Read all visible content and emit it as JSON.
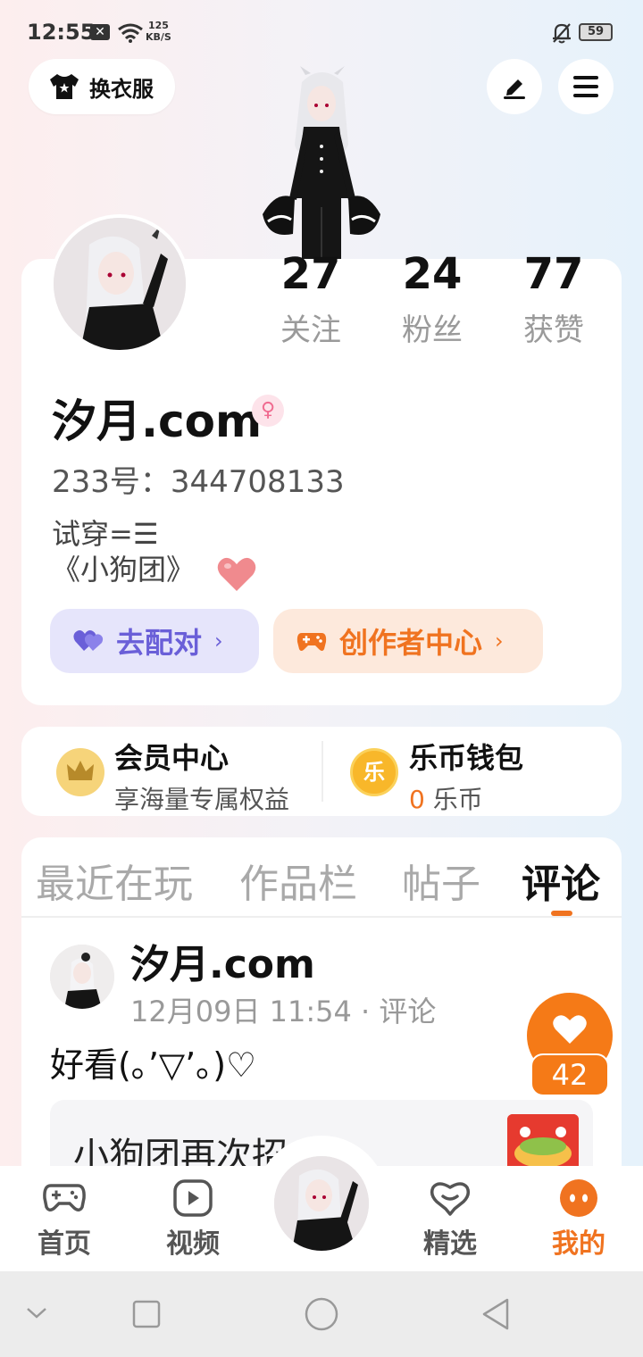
{
  "status_bar": {
    "time": "12:55",
    "notification_badge": "✕",
    "net_speed_value": "125",
    "net_speed_unit": "KB/S",
    "battery": "59"
  },
  "header": {
    "outfit_label": "换衣服"
  },
  "profile": {
    "name": "汐月.com",
    "gender_badge": "♀",
    "id_label": "233号：344708133",
    "bio_line1": "试穿=☰",
    "bio_line2": "《小狗团》",
    "stats": [
      {
        "value": "27",
        "label": "关注"
      },
      {
        "value": "24",
        "label": "粉丝"
      },
      {
        "value": "77",
        "label": "获赞"
      }
    ],
    "match_label": "去配对",
    "creator_label": "创作者中心",
    "chevron": "›"
  },
  "vip": {
    "title": "会员中心",
    "subtitle": "享海量专属权益"
  },
  "wallet": {
    "coin_glyph": "乐",
    "title": "乐币钱包",
    "amount": "0",
    "unit": " 乐币"
  },
  "tabs": [
    {
      "label": "最近在玩",
      "active": false
    },
    {
      "label": "作品栏",
      "active": false
    },
    {
      "label": "帖子",
      "active": false
    },
    {
      "label": "评论",
      "active": true
    }
  ],
  "post": {
    "author": "汐月.com",
    "meta": "12月09日 11:54 · 评论",
    "text": "好看(｡’▽’｡)♡",
    "likes": "42",
    "quote_text": "小狗团再次招"
  },
  "bottom_nav": [
    {
      "label": "首页",
      "icon": "gamepad-icon",
      "active": false
    },
    {
      "label": "视频",
      "icon": "video-play-icon",
      "active": false
    },
    {
      "label": "精选",
      "icon": "heart-chat-icon",
      "active": false
    },
    {
      "label": "我的",
      "icon": "smile-face-icon",
      "active": true
    }
  ],
  "colors": {
    "accent": "#f07320",
    "match_purple": "#6a5fd8",
    "muted_text": "#9a9a9a"
  }
}
